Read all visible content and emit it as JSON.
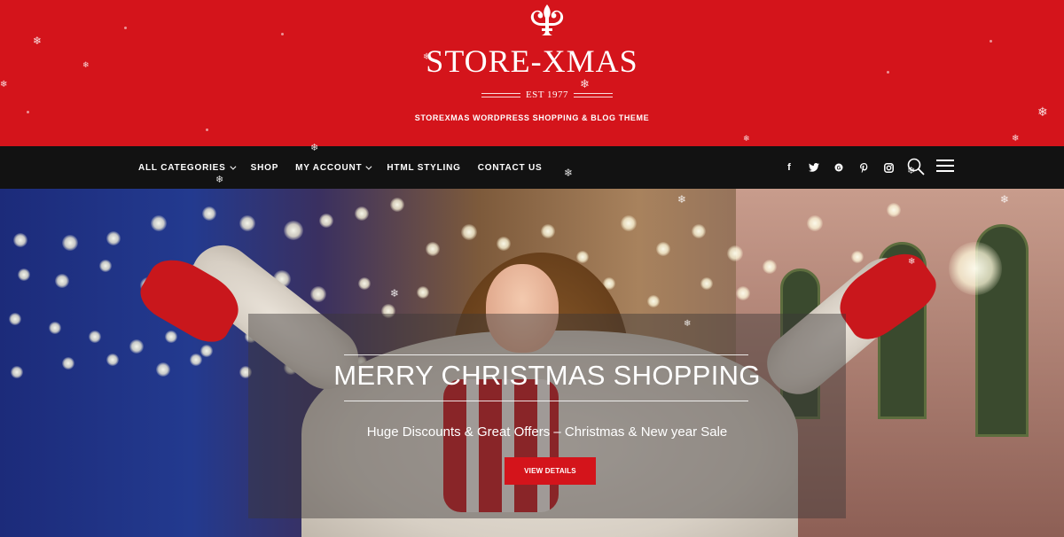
{
  "header": {
    "logo_text": "STORE-XMAS",
    "established": "EST 1977",
    "tagline": "STOREXMAS WORDPRESS SHOPPING & BLOG THEME",
    "background_color": "#d4141b"
  },
  "nav": {
    "items": [
      {
        "label": "ALL CATEGORIES",
        "has_dropdown": true
      },
      {
        "label": "SHOP",
        "has_dropdown": false
      },
      {
        "label": "MY ACCOUNT",
        "has_dropdown": true
      },
      {
        "label": "HTML STYLING",
        "has_dropdown": false
      },
      {
        "label": "CONTACT US",
        "has_dropdown": false
      }
    ],
    "social_icons": [
      "facebook-icon",
      "twitter-icon",
      "google-plus-icon",
      "pinterest-icon",
      "instagram-icon"
    ],
    "background_color": "#121212"
  },
  "hero": {
    "title": "MERRY CHRISTMAS SHOPPING",
    "subtitle": "Huge Discounts & Great Offers – Christmas & New year Sale",
    "button_label": "VIEW DETAILS",
    "button_color": "#d4141b"
  }
}
